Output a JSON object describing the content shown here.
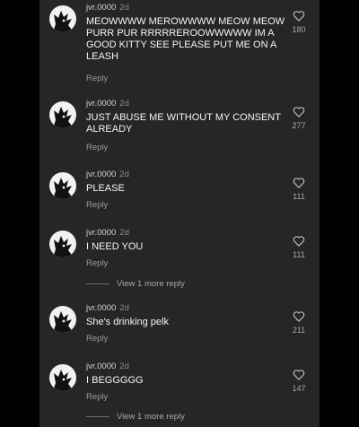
{
  "comments": [
    {
      "username": "jvr.0000",
      "age": "2d",
      "text": "MEOWWWW MEROWWWW MEOW MEOW PURR PUR RRRRREROOWWWWW IM A GOOD KITTY SEE PLEASE PUT ME ON A LEASH",
      "reply_label": "Reply",
      "likes": "180"
    },
    {
      "username": "jvr.0000",
      "age": "2d",
      "text": "JUST ABUSE ME WITHOUT MY CONSENT ALREADY",
      "reply_label": "Reply",
      "likes": "277"
    },
    {
      "username": "jvr.0000",
      "age": "2d",
      "text": "PLEASE",
      "reply_label": "Reply",
      "likes": "111"
    },
    {
      "username": "jvr.0000",
      "age": "2d",
      "text": "I NEED YOU",
      "reply_label": "Reply",
      "likes": "111"
    },
    {
      "username": "jvr.0000",
      "age": "2d",
      "text": "She's drinking pelk",
      "reply_label": "Reply",
      "likes": "211"
    },
    {
      "username": "jvr.0000",
      "age": "2d",
      "text": "I BEGGGGG",
      "reply_label": "Reply",
      "likes": "147"
    }
  ],
  "view_more": [
    "View 1 more reply",
    "View 1 more reply"
  ],
  "colors": {
    "background": "#000000",
    "panel": "#262626",
    "text": "#f5f5f5",
    "secondary": "#a8a8a8"
  },
  "icons": {
    "avatar": "cat-silhouette-avatar",
    "like": "heart-outline-icon"
  }
}
